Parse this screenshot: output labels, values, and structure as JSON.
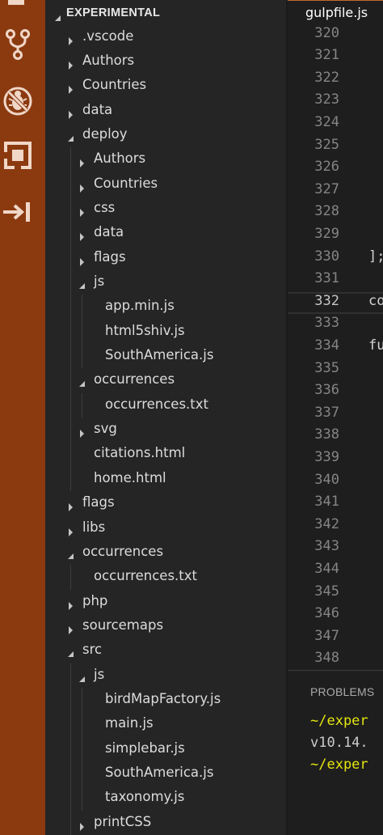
{
  "explorer": {
    "title": "EXPERIMENTAL",
    "items": [
      {
        "label": ".vscode",
        "depth": 0,
        "kind": "folder",
        "expanded": false
      },
      {
        "label": "Authors",
        "depth": 0,
        "kind": "folder",
        "expanded": false
      },
      {
        "label": "Countries",
        "depth": 0,
        "kind": "folder",
        "expanded": false
      },
      {
        "label": "data",
        "depth": 0,
        "kind": "folder",
        "expanded": false
      },
      {
        "label": "deploy",
        "depth": 0,
        "kind": "folder",
        "expanded": true
      },
      {
        "label": "Authors",
        "depth": 1,
        "kind": "folder",
        "expanded": false
      },
      {
        "label": "Countries",
        "depth": 1,
        "kind": "folder",
        "expanded": false
      },
      {
        "label": "css",
        "depth": 1,
        "kind": "folder",
        "expanded": false
      },
      {
        "label": "data",
        "depth": 1,
        "kind": "folder",
        "expanded": false
      },
      {
        "label": "flags",
        "depth": 1,
        "kind": "folder",
        "expanded": false
      },
      {
        "label": "js",
        "depth": 1,
        "kind": "folder",
        "expanded": true
      },
      {
        "label": "app.min.js",
        "depth": 2,
        "kind": "file"
      },
      {
        "label": "html5shiv.js",
        "depth": 2,
        "kind": "file"
      },
      {
        "label": "SouthAmerica.js",
        "depth": 2,
        "kind": "file"
      },
      {
        "label": "occurrences",
        "depth": 1,
        "kind": "folder",
        "expanded": true
      },
      {
        "label": "occurrences.txt",
        "depth": 2,
        "kind": "file"
      },
      {
        "label": "svg",
        "depth": 1,
        "kind": "folder",
        "expanded": false
      },
      {
        "label": "citations.html",
        "depth": 1,
        "kind": "file"
      },
      {
        "label": "home.html",
        "depth": 1,
        "kind": "file"
      },
      {
        "label": "flags",
        "depth": 0,
        "kind": "folder",
        "expanded": false
      },
      {
        "label": "libs",
        "depth": 0,
        "kind": "folder",
        "expanded": false
      },
      {
        "label": "occurrences",
        "depth": 0,
        "kind": "folder",
        "expanded": true
      },
      {
        "label": "occurrences.txt",
        "depth": 1,
        "kind": "file"
      },
      {
        "label": "php",
        "depth": 0,
        "kind": "folder",
        "expanded": false
      },
      {
        "label": "sourcemaps",
        "depth": 0,
        "kind": "folder",
        "expanded": false
      },
      {
        "label": "src",
        "depth": 0,
        "kind": "folder",
        "expanded": true
      },
      {
        "label": "js",
        "depth": 1,
        "kind": "folder",
        "expanded": true
      },
      {
        "label": "birdMapFactory.js",
        "depth": 2,
        "kind": "file"
      },
      {
        "label": "main.js",
        "depth": 2,
        "kind": "file"
      },
      {
        "label": "simplebar.js",
        "depth": 2,
        "kind": "file"
      },
      {
        "label": "SouthAmerica.js",
        "depth": 2,
        "kind": "file"
      },
      {
        "label": "taxonomy.js",
        "depth": 2,
        "kind": "file"
      },
      {
        "label": "printCSS",
        "depth": 1,
        "kind": "folder",
        "expanded": false
      }
    ]
  },
  "editor": {
    "tab_label": "gulpfile.js",
    "current_line": "332",
    "line_numbers": [
      "320",
      "321",
      "322",
      "323",
      "324",
      "325",
      "326",
      "327",
      "328",
      "329",
      "330",
      "331",
      "332",
      "333",
      "334",
      "335",
      "336",
      "337",
      "338",
      "339",
      "340",
      "341",
      "342",
      "343",
      "344",
      "345",
      "346",
      "347",
      "348"
    ],
    "code_fragments": [
      {
        "line": "330",
        "text": "];"
      },
      {
        "line": "332",
        "text": "co"
      },
      {
        "line": "334",
        "text": "fu"
      }
    ]
  },
  "panel": {
    "title": "PROBLEMS",
    "terminal_lines": [
      {
        "text": "~/exper",
        "color": "#e5e510"
      },
      {
        "text": "v10.14.",
        "color": "#cccccc"
      },
      {
        "text": "~/exper",
        "color": "#e5e510"
      }
    ]
  },
  "activity_icons": [
    "explorer-icon",
    "source-control-icon",
    "debug-icon",
    "extensions-icon",
    "panel-toggle-icon"
  ],
  "colors": {
    "activity_bar": "#8b3a10",
    "activity_icon": "#f0d7c8",
    "sidebar_bg": "#252526",
    "editor_bg": "#1e1e1e",
    "tab_accent": "#c36a2b"
  }
}
